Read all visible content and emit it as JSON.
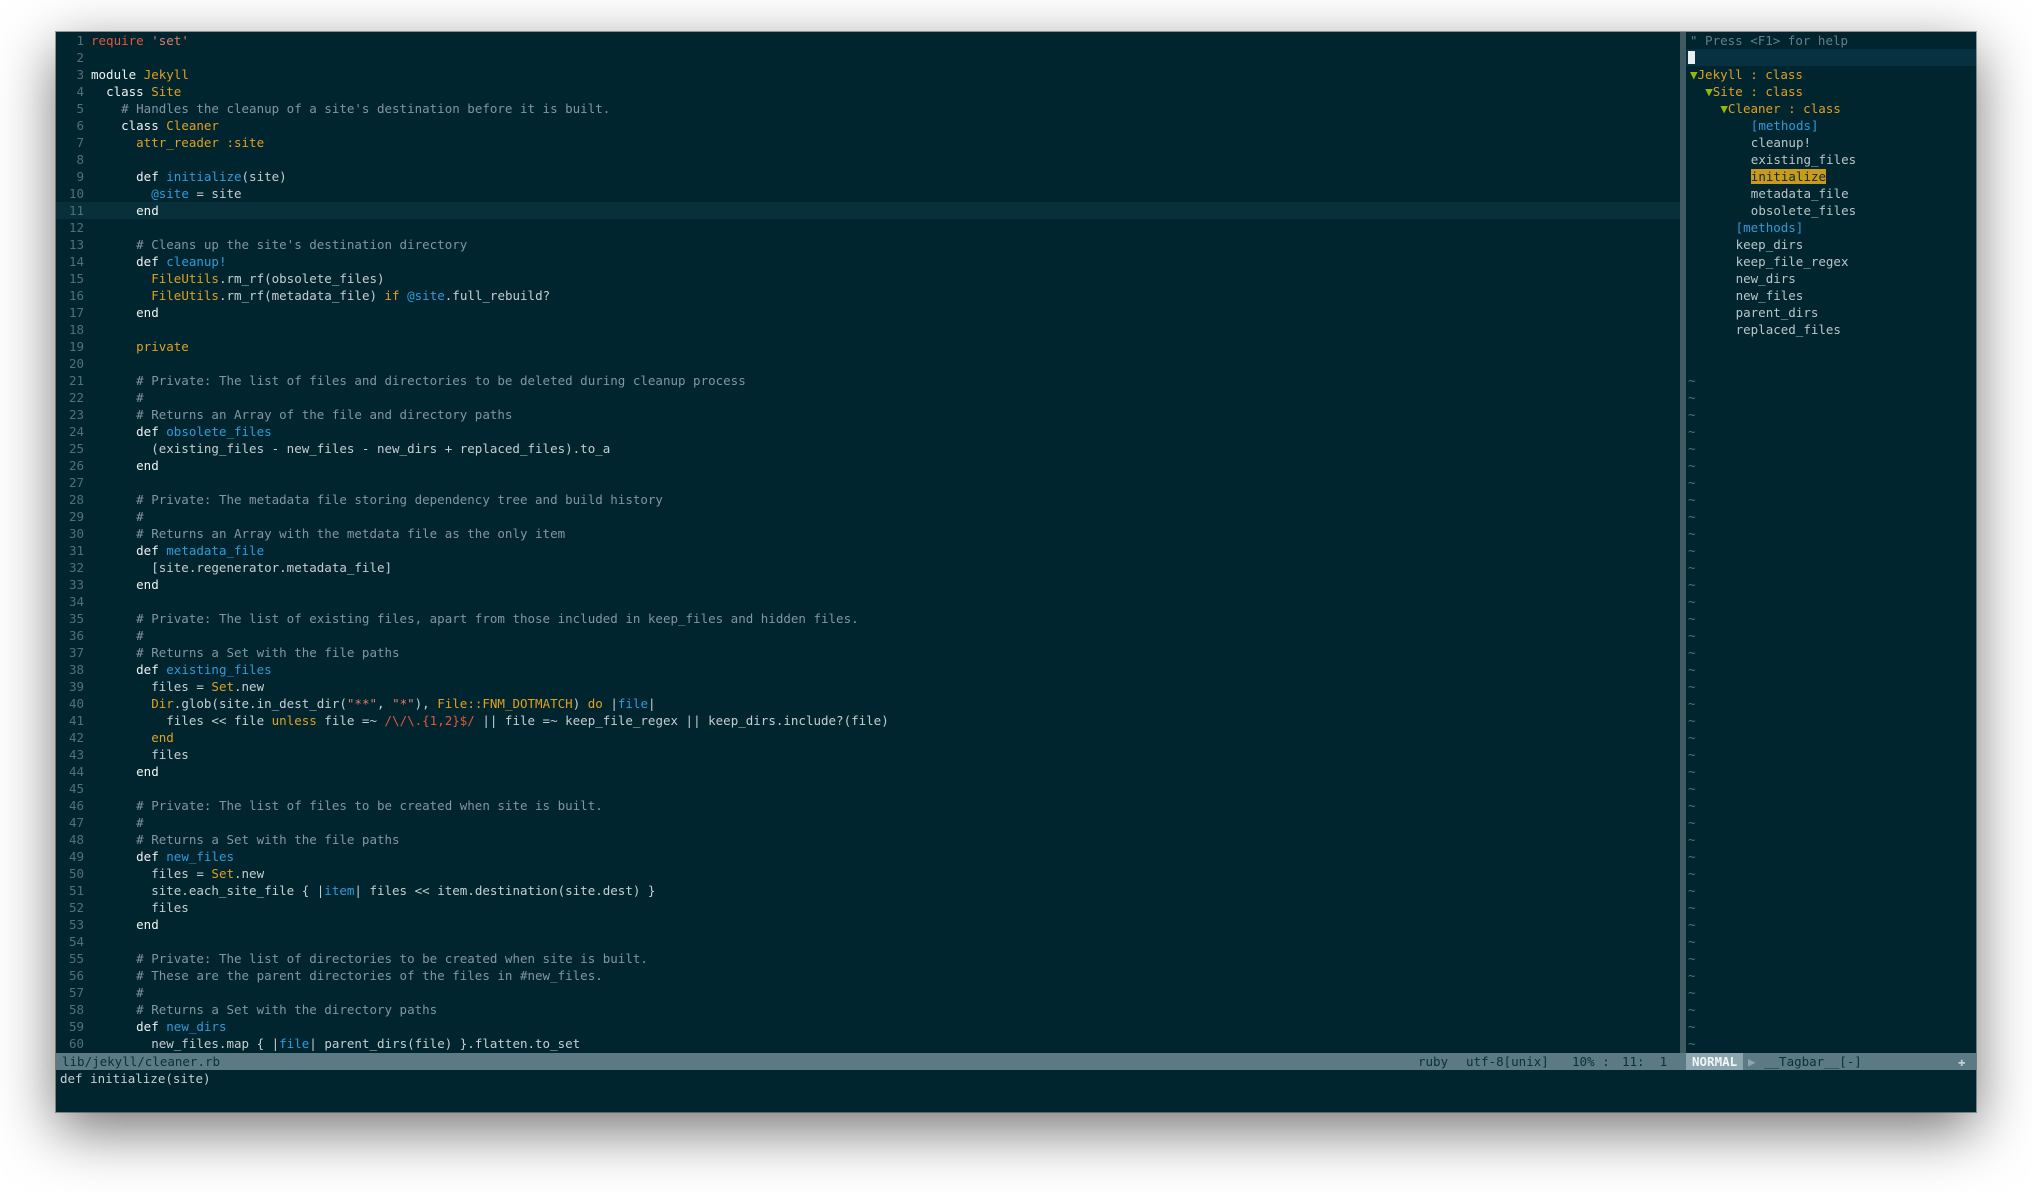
{
  "editor": {
    "lines": [
      [
        [
          "t-req",
          "require"
        ],
        [
          "code",
          " "
        ],
        [
          "t-str",
          "'set'"
        ]
      ],
      [],
      [
        [
          "t-mod",
          "module"
        ],
        [
          "code",
          " "
        ],
        [
          "t-cls",
          "Jekyll"
        ]
      ],
      [
        [
          "code",
          "  "
        ],
        [
          "t-kw",
          "class"
        ],
        [
          "code",
          " "
        ],
        [
          "t-cls",
          "Site"
        ]
      ],
      [
        [
          "code",
          "    "
        ],
        [
          "t-cmt",
          "# Handles the cleanup of a site's destination before it is built."
        ]
      ],
      [
        [
          "code",
          "    "
        ],
        [
          "t-kw",
          "class"
        ],
        [
          "code",
          " "
        ],
        [
          "t-cls",
          "Cleaner"
        ]
      ],
      [
        [
          "code",
          "      "
        ],
        [
          "t-ctl",
          "attr_reader"
        ],
        [
          "code",
          " "
        ],
        [
          "t-sym",
          ":site"
        ]
      ],
      [],
      [
        [
          "code",
          "      "
        ],
        [
          "t-kw",
          "def"
        ],
        [
          "code",
          " "
        ],
        [
          "t-fn",
          "initialize"
        ],
        [
          "code",
          "(site)"
        ]
      ],
      [
        [
          "code",
          "        "
        ],
        [
          "t-ivar",
          "@site"
        ],
        [
          "code",
          " = site"
        ]
      ],
      [
        [
          "code",
          "      "
        ],
        [
          "t-kw",
          "end"
        ]
      ],
      [],
      [
        [
          "code",
          "      "
        ],
        [
          "t-cmt",
          "# Cleans up the site's destination directory"
        ]
      ],
      [
        [
          "code",
          "      "
        ],
        [
          "t-kw",
          "def"
        ],
        [
          "code",
          " "
        ],
        [
          "t-fn",
          "cleanup!"
        ]
      ],
      [
        [
          "code",
          "        "
        ],
        [
          "t-cnst",
          "FileUtils"
        ],
        [
          "code",
          ".rm_rf(obsolete_files)"
        ]
      ],
      [
        [
          "code",
          "        "
        ],
        [
          "t-cnst",
          "FileUtils"
        ],
        [
          "code",
          ".rm_rf(metadata_file) "
        ],
        [
          "t-ctl",
          "if"
        ],
        [
          "code",
          " "
        ],
        [
          "t-ivar",
          "@site"
        ],
        [
          "code",
          ".full_rebuild?"
        ]
      ],
      [
        [
          "code",
          "      "
        ],
        [
          "t-kw",
          "end"
        ]
      ],
      [],
      [
        [
          "code",
          "      "
        ],
        [
          "t-ctl",
          "private"
        ]
      ],
      [],
      [
        [
          "code",
          "      "
        ],
        [
          "t-cmt",
          "# Private: The list of files and directories to be deleted during cleanup process"
        ]
      ],
      [
        [
          "code",
          "      "
        ],
        [
          "t-cmt",
          "#"
        ]
      ],
      [
        [
          "code",
          "      "
        ],
        [
          "t-cmt",
          "# Returns an Array of the file and directory paths"
        ]
      ],
      [
        [
          "code",
          "      "
        ],
        [
          "t-kw",
          "def"
        ],
        [
          "code",
          " "
        ],
        [
          "t-fn",
          "obsolete_files"
        ]
      ],
      [
        [
          "code",
          "        (existing_files - new_files - new_dirs + replaced_files).to_a"
        ]
      ],
      [
        [
          "code",
          "      "
        ],
        [
          "t-kw",
          "end"
        ]
      ],
      [],
      [
        [
          "code",
          "      "
        ],
        [
          "t-cmt",
          "# Private: The metadata file storing dependency tree and build history"
        ]
      ],
      [
        [
          "code",
          "      "
        ],
        [
          "t-cmt",
          "#"
        ]
      ],
      [
        [
          "code",
          "      "
        ],
        [
          "t-cmt",
          "# Returns an Array with the metdata file as the only item"
        ]
      ],
      [
        [
          "code",
          "      "
        ],
        [
          "t-kw",
          "def"
        ],
        [
          "code",
          " "
        ],
        [
          "t-fn",
          "metadata_file"
        ]
      ],
      [
        [
          "code",
          "        [site.regenerator.metadata_file]"
        ]
      ],
      [
        [
          "code",
          "      "
        ],
        [
          "t-kw",
          "end"
        ]
      ],
      [],
      [
        [
          "code",
          "      "
        ],
        [
          "t-cmt",
          "# Private: The list of existing files, apart from those included in keep_files and hidden files."
        ]
      ],
      [
        [
          "code",
          "      "
        ],
        [
          "t-cmt",
          "#"
        ]
      ],
      [
        [
          "code",
          "      "
        ],
        [
          "t-cmt",
          "# Returns a Set with the file paths"
        ]
      ],
      [
        [
          "code",
          "      "
        ],
        [
          "t-kw",
          "def"
        ],
        [
          "code",
          " "
        ],
        [
          "t-fn",
          "existing_files"
        ]
      ],
      [
        [
          "code",
          "        files = "
        ],
        [
          "t-cnst",
          "Set"
        ],
        [
          "code",
          ".new"
        ]
      ],
      [
        [
          "code",
          "        "
        ],
        [
          "t-cnst",
          "Dir"
        ],
        [
          "code",
          ".glob(site.in_dest_dir("
        ],
        [
          "t-str",
          "\"**\""
        ],
        [
          "code",
          ", "
        ],
        [
          "t-str",
          "\"*\""
        ],
        [
          "code",
          "), "
        ],
        [
          "t-cnst",
          "File::FNM_DOTMATCH"
        ],
        [
          "code",
          ") "
        ],
        [
          "t-ctl",
          "do"
        ],
        [
          "code",
          " |"
        ],
        [
          "t-pp",
          "file"
        ],
        [
          "code",
          "|"
        ]
      ],
      [
        [
          "code",
          "          files << file "
        ],
        [
          "t-ctl",
          "unless"
        ],
        [
          "code",
          " file =~ "
        ],
        [
          "t-rx",
          "/\\/\\.{1,2}$/"
        ],
        [
          "code",
          " || file =~ keep_file_regex || keep_dirs.include?(file)"
        ]
      ],
      [
        [
          "code",
          "        "
        ],
        [
          "t-ctl",
          "end"
        ]
      ],
      [
        [
          "code",
          "        files"
        ]
      ],
      [
        [
          "code",
          "      "
        ],
        [
          "t-kw",
          "end"
        ]
      ],
      [],
      [
        [
          "code",
          "      "
        ],
        [
          "t-cmt",
          "# Private: The list of files to be created when site is built."
        ]
      ],
      [
        [
          "code",
          "      "
        ],
        [
          "t-cmt",
          "#"
        ]
      ],
      [
        [
          "code",
          "      "
        ],
        [
          "t-cmt",
          "# Returns a Set with the file paths"
        ]
      ],
      [
        [
          "code",
          "      "
        ],
        [
          "t-kw",
          "def"
        ],
        [
          "code",
          " "
        ],
        [
          "t-fn",
          "new_files"
        ]
      ],
      [
        [
          "code",
          "        files = "
        ],
        [
          "t-cnst",
          "Set"
        ],
        [
          "code",
          ".new"
        ]
      ],
      [
        [
          "code",
          "        site.each_site_file { |"
        ],
        [
          "t-pp",
          "item"
        ],
        [
          "code",
          "| files << item.destination(site.dest) }"
        ]
      ],
      [
        [
          "code",
          "        files"
        ]
      ],
      [
        [
          "code",
          "      "
        ],
        [
          "t-kw",
          "end"
        ]
      ],
      [],
      [
        [
          "code",
          "      "
        ],
        [
          "t-cmt",
          "# Private: The list of directories to be created when site is built."
        ]
      ],
      [
        [
          "code",
          "      "
        ],
        [
          "t-cmt",
          "# These are the parent directories of the files in #new_files."
        ]
      ],
      [
        [
          "code",
          "      "
        ],
        [
          "t-cmt",
          "#"
        ]
      ],
      [
        [
          "code",
          "      "
        ],
        [
          "t-cmt",
          "# Returns a Set with the directory paths"
        ]
      ],
      [
        [
          "code",
          "      "
        ],
        [
          "t-kw",
          "def"
        ],
        [
          "code",
          " "
        ],
        [
          "t-fn",
          "new_dirs"
        ]
      ],
      [
        [
          "code",
          "        new_files.map { |"
        ],
        [
          "t-pp",
          "file"
        ],
        [
          "code",
          "| parent_dirs(file) }.flatten.to_set"
        ]
      ]
    ],
    "current_line": 11
  },
  "tagbar": {
    "help": "\" Press <F1> for help",
    "fold_icon": "▼",
    "tree": [
      {
        "indent": 0,
        "fold": true,
        "name": "Jekyll",
        "kind": " : class"
      },
      {
        "indent": 1,
        "fold": true,
        "name": "Site",
        "kind": " : class"
      },
      {
        "indent": 2,
        "fold": true,
        "name": "Cleaner",
        "kind": " : class"
      },
      {
        "indent": 4,
        "head": "[methods]"
      },
      {
        "indent": 4,
        "item": "cleanup!"
      },
      {
        "indent": 4,
        "item": "existing_files"
      },
      {
        "indent": 4,
        "item": "initialize",
        "highlight": true
      },
      {
        "indent": 4,
        "item": "metadata_file"
      },
      {
        "indent": 4,
        "item": "obsolete_files"
      },
      {
        "indent": 3,
        "head": "[methods]"
      },
      {
        "indent": 3,
        "item": "keep_dirs"
      },
      {
        "indent": 3,
        "item": "keep_file_regex"
      },
      {
        "indent": 3,
        "item": "new_dirs"
      },
      {
        "indent": 3,
        "item": "new_files"
      },
      {
        "indent": 3,
        "item": "parent_dirs"
      },
      {
        "indent": 3,
        "item": "replaced_files"
      }
    ],
    "tilde": "~",
    "first_tilde_line": 19
  },
  "status": {
    "file": "lib/jekyll/cleaner.rb",
    "filetype": "ruby",
    "encoding": "utf-8[unix]",
    "percent": "10% :",
    "position": "11:  1",
    "mode": "NORMAL",
    "mode_arrow": "▶",
    "tagbar_name": "__Tagbar__[-]",
    "corner": "✚"
  },
  "cmdline": "def initialize(site)"
}
